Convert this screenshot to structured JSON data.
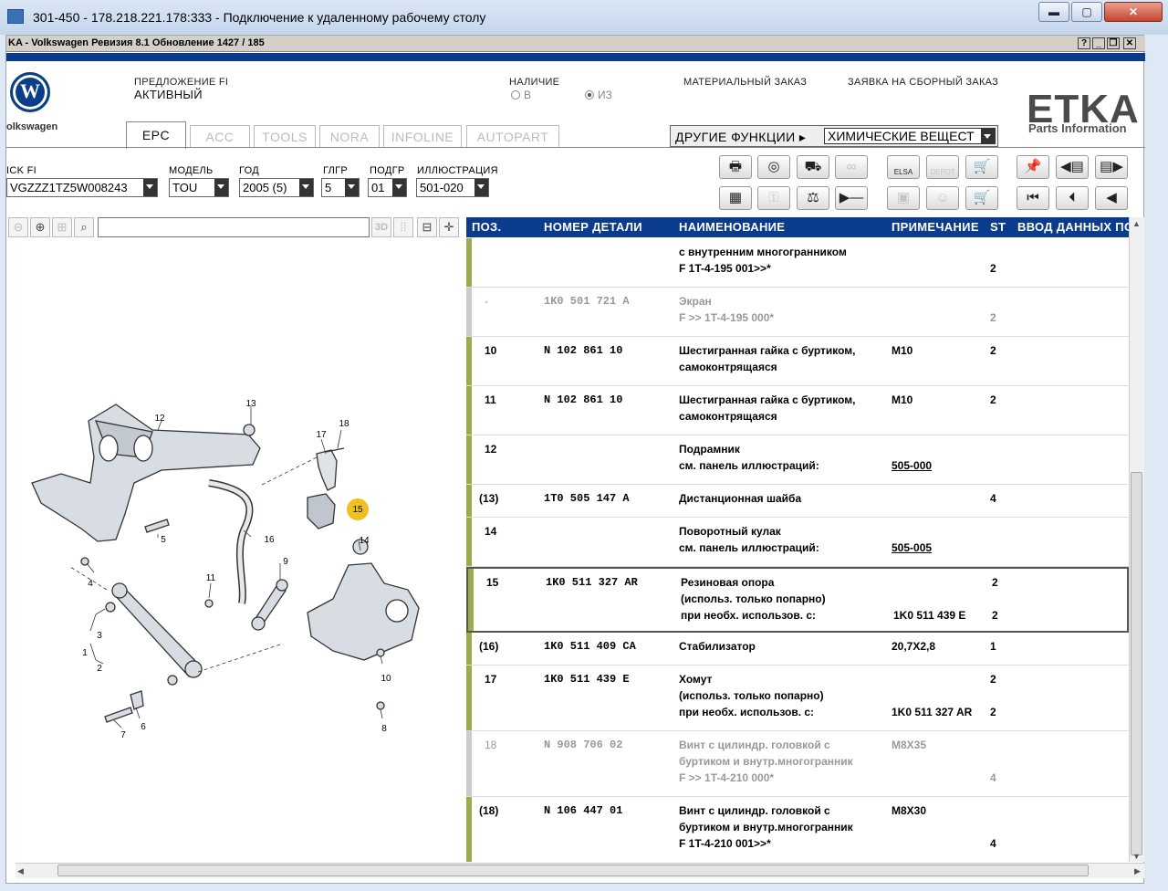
{
  "rdp": {
    "title": "301-450 - 178.218.221.178:333 - Подключение к удаленному рабочему столу",
    "min": "▬",
    "max": "▢",
    "close": "✕"
  },
  "app": {
    "title": "KA - Volkswagen Ревизия 8.1 Обновление 1427 / 185",
    "sys_buttons": [
      "?",
      "_",
      "❐",
      "✕"
    ]
  },
  "header": {
    "brand_text": "olkswagen",
    "offer_label": "ПРЕДЛОЖЕНИЕ FI",
    "offer_value": "АКТИВНЫЙ",
    "availability_label": "НАЛИЧИЕ",
    "radio_in": "В",
    "radio_from": "ИЗ",
    "material_order": "МАТЕРИАЛЬНЫЙ ЗАКАЗ",
    "assembly_order": "ЗАЯВКА НА СБОРНЫЙ ЗАКАЗ",
    "etka_logo": "ETKA",
    "etka_sub": "Parts Information"
  },
  "tabs": [
    "EPC",
    "ACC",
    "TOOLS",
    "NORA",
    "INFOLINE",
    "AUTOPART"
  ],
  "other_functions": {
    "label": "ДРУГИЕ ФУНКЦИИ ▸",
    "selected": "ХИМИЧЕСКИЕ ВЕЩЕСТ"
  },
  "selection": {
    "vin_label": "ICK FI",
    "vin_value": "VGZZZ1TZ5W008243",
    "model_label": "МОДЕЛЬ",
    "model_value": "TOU",
    "year_label": "ГОД",
    "year_value": "2005 (5)",
    "group_label": "ГЛГР",
    "group_value": "5",
    "subgroup_label": "ПОДГР",
    "subgroup_value": "01",
    "illustration_label": "ИЛЛЮСТРАЦИЯ",
    "illustration_value": "501-020"
  },
  "toolbar_icons": [
    "print-icon",
    "cd-icon",
    "cars-icon",
    "glasses-icon",
    "elsa-icon",
    "depot-icon",
    "cart-icon",
    "pin-icon",
    "page-prev-icon",
    "page-next-icon",
    "list-icon",
    "key-icon",
    "scale-icon",
    "play-step-icon",
    "service-icon",
    "user-icon",
    "cart-add-icon",
    "first-icon",
    "prev-icon",
    "back-icon"
  ],
  "toolbar_labels": {
    "elsa": "ELSA",
    "depot": "DEPOT"
  },
  "illus_toolbar": {
    "three_d": "3D"
  },
  "table": {
    "headers": [
      "ПОЗ.",
      "НОМЕР ДЕТАЛИ",
      "НАИМЕНОВАНИЕ",
      "ПРИМЕЧАНИЕ",
      "ST",
      "ВВОД ДАННЫХ ПО"
    ],
    "rows": [
      {
        "pos": "",
        "part": "",
        "lines": [
          "с внутренним многогранником",
          "F 1T-4-195 001>>*"
        ],
        "note": "",
        "qty": [
          "",
          "2"
        ],
        "grey": false
      },
      {
        "pos": "-",
        "part": "1K0  501  721  A",
        "lines": [
          "Экран",
          "F            >> 1T-4-195 000*"
        ],
        "note": "",
        "qty": [
          "",
          "2"
        ],
        "grey": true
      },
      {
        "pos": "10",
        "part": "N    102  861  10",
        "lines": [
          "Шестигранная гайка с буртиком,",
          "самоконтрящаяся"
        ],
        "note": "M10",
        "qty": [
          "2"
        ],
        "grey": false
      },
      {
        "pos": "11",
        "part": "N    102  861  10",
        "lines": [
          "Шестигранная гайка с буртиком,",
          "самоконтрящаяся"
        ],
        "note": "M10",
        "qty": [
          "2"
        ],
        "grey": false
      },
      {
        "pos": "12",
        "part": "",
        "lines": [
          "Подрамник",
          "           см. панель иллюстраций:"
        ],
        "note": "505-000",
        "note_line": 1,
        "qty": [],
        "grey": false
      },
      {
        "pos": "(13)",
        "part": "1T0  505  147  A",
        "lines": [
          "Дистанционная шайба"
        ],
        "note": "",
        "qty": [
          "4"
        ],
        "grey": false
      },
      {
        "pos": "14",
        "part": "",
        "lines": [
          "Поворотный кулак",
          "           см. панель иллюстраций:"
        ],
        "note": "505-005",
        "note_line": 1,
        "qty": [],
        "grey": false
      },
      {
        "pos": "15",
        "part": "1K0  511  327  AR",
        "lines": [
          "Резиновая опора",
          "(использ. только попарно)",
          "           при необх. использов. с:"
        ],
        "note": "1K0 511 439 E",
        "note_line": 2,
        "qty": [
          "2",
          "",
          "2"
        ],
        "grey": false,
        "selected": true
      },
      {
        "pos": "(16)",
        "part": "1K0  511  409  CA",
        "lines": [
          "Стабилизатор"
        ],
        "note": "20,7X2,8",
        "qty": [
          "1"
        ],
        "grey": false
      },
      {
        "pos": "17",
        "part": "1K0  511  439  E",
        "lines": [
          "Хомут",
          "(использ. только попарно)",
          "           при необх. использов. с:"
        ],
        "note": "1K0 511 327 AR",
        "note_line": 2,
        "qty": [
          "2",
          "",
          "2"
        ],
        "grey": false
      },
      {
        "pos": "18",
        "part": "N    908  706  02",
        "lines": [
          "Винт с цилиндр. головкой с",
          "буртиком и внутр.многогранник",
          "F            >> 1T-4-210 000*"
        ],
        "note": "M8X35",
        "qty": [
          "",
          "",
          "4"
        ],
        "grey": true
      },
      {
        "pos": "(18)",
        "part": "N    106  447  01",
        "lines": [
          "Винт с цилиндр. головкой с",
          "буртиком и внутр.многогранник",
          "F 1T-4-210 001>>*"
        ],
        "note": "M8X30",
        "qty": [
          "",
          "",
          "4"
        ],
        "grey": false
      }
    ]
  },
  "diagram_labels": [
    "12",
    "13",
    "17",
    "18",
    "15",
    "5",
    "16",
    "4",
    "14",
    "9",
    "11",
    "3",
    "1",
    "2",
    "10",
    "7",
    "6",
    "8"
  ],
  "colors": {
    "header_blue": "#0b3b8c",
    "row_bar": "#9aac4c",
    "highlight_marker": "#f0c020"
  }
}
